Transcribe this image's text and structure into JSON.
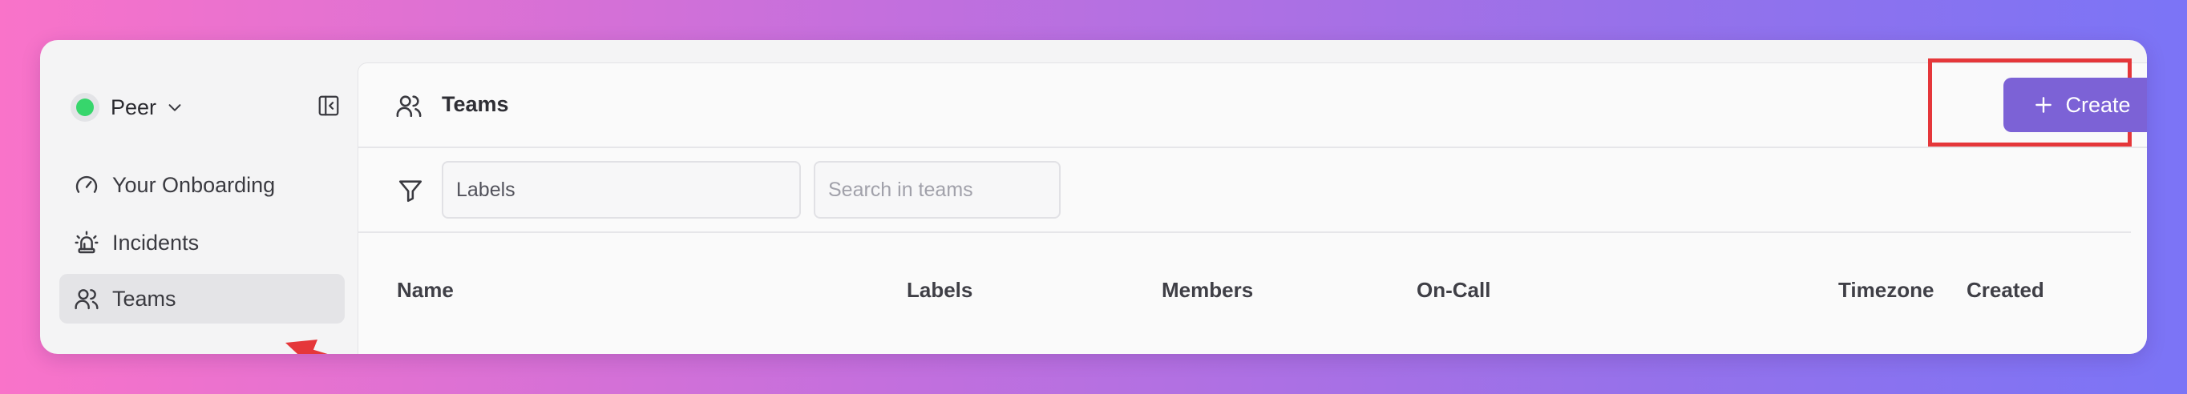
{
  "workspace": {
    "name": "Peer",
    "status_color": "#37d66c"
  },
  "sidebar": {
    "items": [
      {
        "label": "Your Onboarding",
        "icon": "gauge-icon"
      },
      {
        "label": "Incidents",
        "icon": "siren-icon"
      },
      {
        "label": "Teams",
        "icon": "users-icon",
        "active": true
      }
    ]
  },
  "page": {
    "title": "Teams",
    "title_icon": "users-icon"
  },
  "toolbar": {
    "create_label": "Create",
    "accent_color": "#7c62d6"
  },
  "filters": {
    "labels_placeholder": "Labels",
    "search_placeholder": "Search in teams"
  },
  "table": {
    "columns": [
      "Name",
      "Labels",
      "Members",
      "On-Call",
      "Timezone",
      "Created"
    ]
  },
  "annotations": {
    "highlight_color": "#e5373a"
  }
}
